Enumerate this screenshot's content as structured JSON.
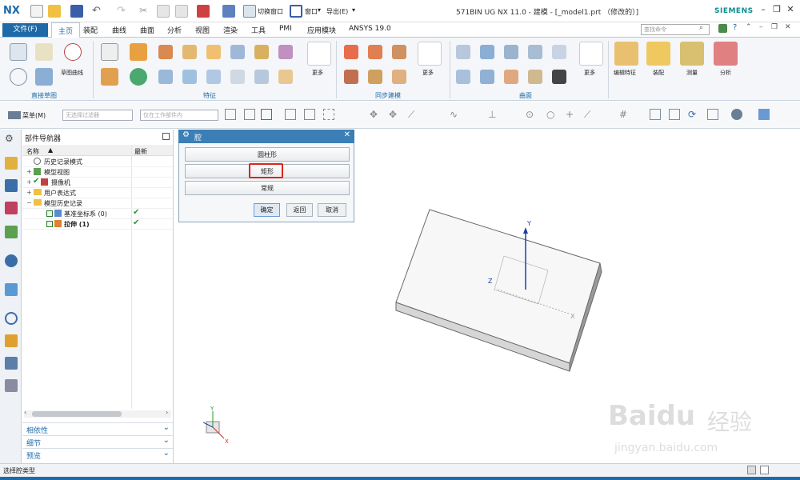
{
  "app": {
    "logo": "NX",
    "title": "571BIN UG NX 11.0 - 建模 - [_model1.prt （修改的）]",
    "brand": "SIEMENS",
    "switch_window": "切换窗口",
    "window_menu": "窗口",
    "export_menu": "导出(E)"
  },
  "tabs": {
    "file": "文件(F)",
    "items": [
      "主页",
      "装配",
      "曲线",
      "曲面",
      "分析",
      "视图",
      "渲染",
      "工具",
      "PMI",
      "应用模块",
      "ANSYS 19.0"
    ],
    "active": "主页"
  },
  "command_search": {
    "placeholder": "查找命令"
  },
  "ribbon": {
    "groups": {
      "direct_sketch": "直接草图",
      "feature": "特征",
      "sync_modeling": "同步建模",
      "surface": "曲面"
    },
    "labels": {
      "sketch_curve": "草图曲线",
      "more1": "更多",
      "more2": "更多",
      "more3": "更多",
      "edit_feature": "编辑特征",
      "assembly": "装配",
      "measure": "测量",
      "analysis": "分析"
    }
  },
  "toolbar2": {
    "menu": "菜单(M)",
    "filter_placeholder": "无选择过滤器",
    "assembly_scope": "仅在工作部件内"
  },
  "navigator": {
    "title": "部件导航器",
    "col_name": "名称",
    "col_latest": "最新",
    "rows": [
      {
        "label": "历史记录模式",
        "indent": 0
      },
      {
        "label": "模型视图",
        "indent": 0
      },
      {
        "label": "摄像机",
        "indent": 0
      },
      {
        "label": "用户表达式",
        "indent": 0
      },
      {
        "label": "模型历史记录",
        "indent": 0
      },
      {
        "label": "基准坐标系 (0)",
        "indent": 1
      },
      {
        "label": "拉伸 (1)",
        "indent": 1
      }
    ],
    "panels": [
      "相依性",
      "细节",
      "预览"
    ]
  },
  "dialog": {
    "title": "腔",
    "options": [
      "圆柱形",
      "矩形",
      "常规"
    ],
    "highlighted": "矩形",
    "ok": "确定",
    "back": "返回",
    "cancel": "取消"
  },
  "viewport": {
    "axis_labels": {
      "y": "Y",
      "x": "X",
      "z": "Z"
    }
  },
  "status": {
    "text": "选择腔类型"
  },
  "watermark": {
    "brand": "Baidu",
    "cn": "经验",
    "url": "jingyan.baidu.com"
  },
  "colors": {
    "accent": "#1e6aa8",
    "check": "#2a9a2a",
    "highlight": "#d9261c"
  }
}
